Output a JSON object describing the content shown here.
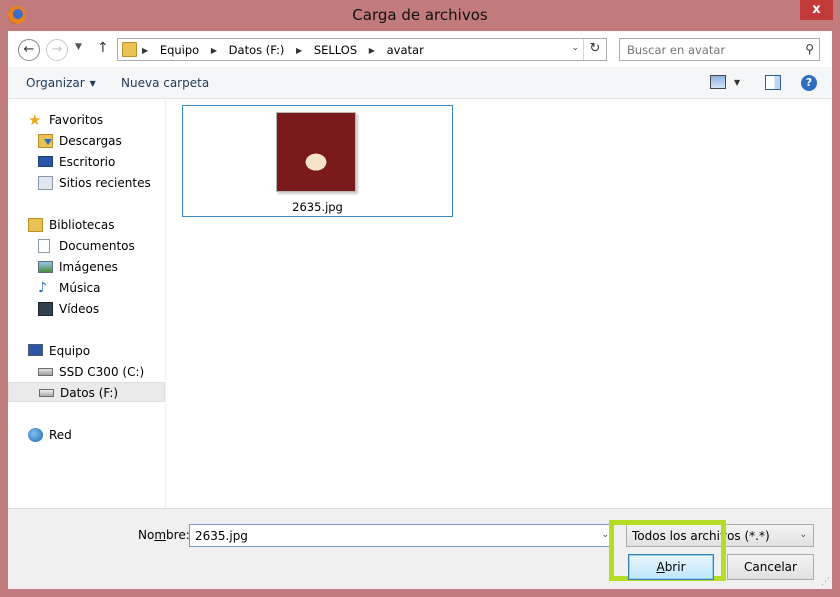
{
  "window": {
    "title": "Carga de archivos",
    "close_label": "x"
  },
  "navigation": {
    "back_glyph": "←",
    "forward_glyph": "→",
    "recent_glyph": "▼",
    "up_glyph": "↑",
    "breadcrumb": [
      "Equipo",
      "Datos (F:)",
      "SELLOS",
      "avatar"
    ],
    "breadcrumb_separator": "▶",
    "dropdown_glyph": "⌄",
    "refresh_glyph": "↻",
    "search_placeholder": "Buscar en avatar",
    "search_glyph": "⚲"
  },
  "toolbar": {
    "organize_label": "Organizar",
    "organize_caret": "▼",
    "new_folder_label": "Nueva carpeta",
    "view_caret": "▼",
    "help_label": "?"
  },
  "sidebar": {
    "items": [
      {
        "label": "Favoritos",
        "icon": "star-icon"
      },
      {
        "label": "Descargas",
        "icon": "downloads-folder-icon"
      },
      {
        "label": "Escritorio",
        "icon": "desktop-icon"
      },
      {
        "label": "Sitios recientes",
        "icon": "recent-places-icon"
      },
      {
        "label": "Bibliotecas",
        "icon": "libraries-icon"
      },
      {
        "label": "Documentos",
        "icon": "documents-icon"
      },
      {
        "label": "Imágenes",
        "icon": "pictures-icon"
      },
      {
        "label": "Música",
        "icon": "music-icon"
      },
      {
        "label": "Vídeos",
        "icon": "videos-icon"
      },
      {
        "label": "Equipo",
        "icon": "computer-icon"
      },
      {
        "label": "SSD C300 (C:)",
        "icon": "drive-icon"
      },
      {
        "label": "Datos (F:)",
        "icon": "usb-drive-icon",
        "selected": true
      },
      {
        "label": "Red",
        "icon": "network-icon"
      }
    ]
  },
  "files": [
    {
      "name": "2635.jpg",
      "thumbnail": "hyena-thumbnail"
    }
  ],
  "footer": {
    "name_label_before": "No",
    "name_label_underline": "m",
    "name_label_after": "bre:",
    "filename_value": "2635.jpg",
    "name_dropdown_glyph": "⌄",
    "filetype_value": "Todos los archivos (*.*)",
    "filetype_dropdown_glyph": "⌄",
    "open_underline": "A",
    "open_rest": "brir",
    "cancel_label": "Cancelar",
    "grip_glyph": "⋰"
  },
  "colors": {
    "frame": "#c27b7d",
    "close_button": "#c2393a",
    "highlight": "#b6dd25",
    "selection_border": "#3c8cc4"
  }
}
